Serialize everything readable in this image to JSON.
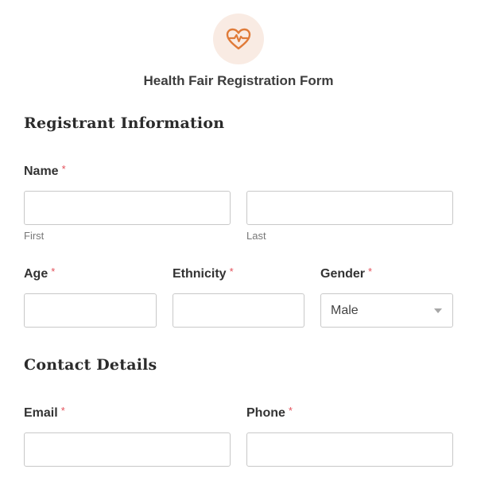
{
  "brand": {
    "accent": "#e07b39",
    "logo_bg": "#f9ebe3",
    "required_color": "#e3505a",
    "logo_icon": "heart-pulse-icon"
  },
  "form": {
    "title": "Health Fair Registration Form"
  },
  "sections": {
    "registrant": {
      "title": "Registrant Information"
    },
    "contact": {
      "title": "Contact Details"
    }
  },
  "fields": {
    "name": {
      "label": "Name",
      "required": "*",
      "first_value": "",
      "last_value": "",
      "first_sublabel": "First",
      "last_sublabel": "Last"
    },
    "age": {
      "label": "Age",
      "required": "*",
      "value": ""
    },
    "ethnicity": {
      "label": "Ethnicity",
      "required": "*",
      "value": ""
    },
    "gender": {
      "label": "Gender",
      "required": "*",
      "selected": "Male",
      "icon": "chevron-down-icon"
    },
    "email": {
      "label": "Email",
      "required": "*",
      "value": ""
    },
    "phone": {
      "label": "Phone",
      "required": "*",
      "value": ""
    }
  }
}
